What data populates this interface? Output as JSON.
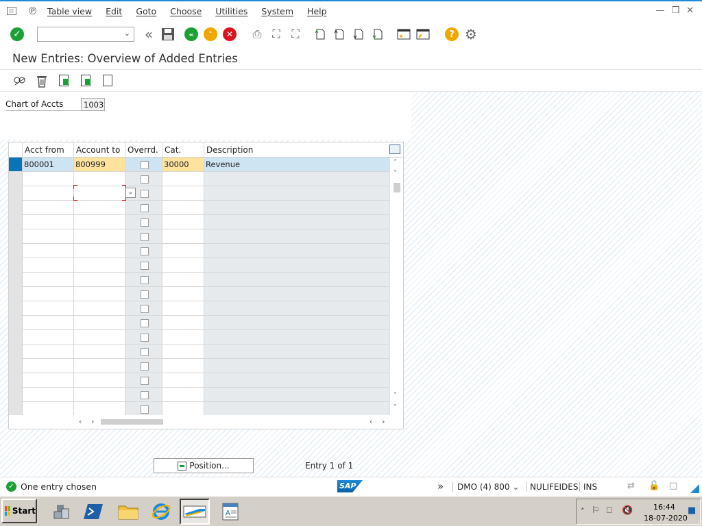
{
  "menubar": {
    "items": [
      "Table view",
      "Edit",
      "Goto",
      "Choose",
      "Utilities",
      "System",
      "Help"
    ]
  },
  "toolbar": {
    "command_field_value": "",
    "icons": [
      "enter-icon",
      "command-field",
      "collapse-icon",
      "save-icon",
      "back-icon",
      "exit-icon",
      "cancel-icon",
      "print-icon",
      "find-icon",
      "find-next-icon",
      "first-page-icon",
      "previous-page-icon",
      "next-page-icon",
      "last-page-icon",
      "create-session-icon",
      "shortcut-icon",
      "help-icon",
      "customize-layout-icon"
    ]
  },
  "title": "New Entries: Overview of Added Entries",
  "app_toolbar": {
    "icons": [
      "display-change-icon",
      "delete-icon",
      "select-all-icon",
      "select-block-icon",
      "deselect-all-icon"
    ]
  },
  "header_field": {
    "label": "Chart of Accts",
    "value": "1003"
  },
  "table": {
    "columns": [
      "Acct from",
      "Account to",
      "Overrd.",
      "Cat.",
      "Description"
    ],
    "rows": [
      {
        "acct_from": "800001",
        "account_to": "800999",
        "overrd": false,
        "cat": "30000",
        "description": "Revenue"
      }
    ],
    "empty_rows": 17
  },
  "buttons": {
    "position_label": "Position..."
  },
  "entry_count": "Entry 1 of 1",
  "statusbar": {
    "message": "One entry chosen",
    "system": "DMO (4) 800",
    "user": "NULIFEIDES",
    "mode": "INS"
  },
  "taskbar": {
    "start_label": "Start",
    "time": "16:44",
    "date": "18-07-2020"
  },
  "colors": {
    "selected_row": "#cfe4f3",
    "key_highlight": "#fde39e",
    "accent": "#1e8ad6"
  }
}
